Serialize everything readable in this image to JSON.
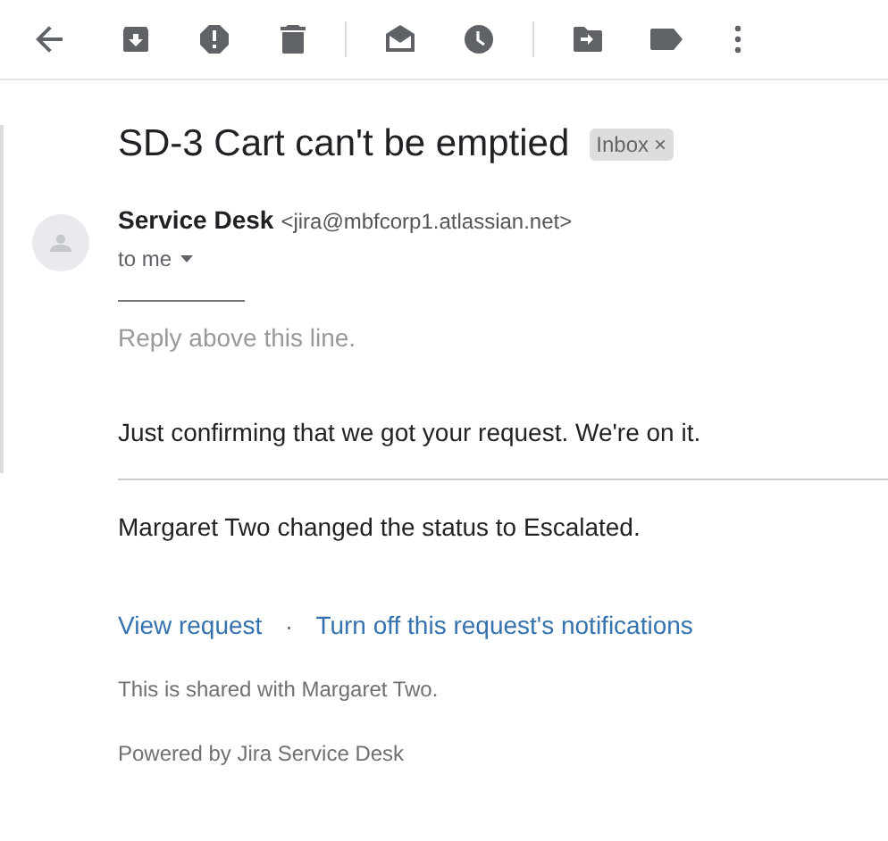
{
  "subject": "SD-3 Cart can't be emptied",
  "labels": [
    {
      "text": "Inbox",
      "remove": "×"
    }
  ],
  "sender": {
    "name": "Service Desk",
    "email": "<jira@mbfcorp1.atlassian.net>",
    "recipient": "to me"
  },
  "body": {
    "reply_hint": "Reply above this line.",
    "message": "Just confirming that we got your request. We're on it.",
    "status_change": "Margaret Two changed the status to Escalated.",
    "links": [
      "View request",
      "Turn off this request's notifications"
    ],
    "link_separator": "·",
    "shared_note": "This is shared with Margaret Two.",
    "footer": "Powered by Jira Service Desk"
  }
}
